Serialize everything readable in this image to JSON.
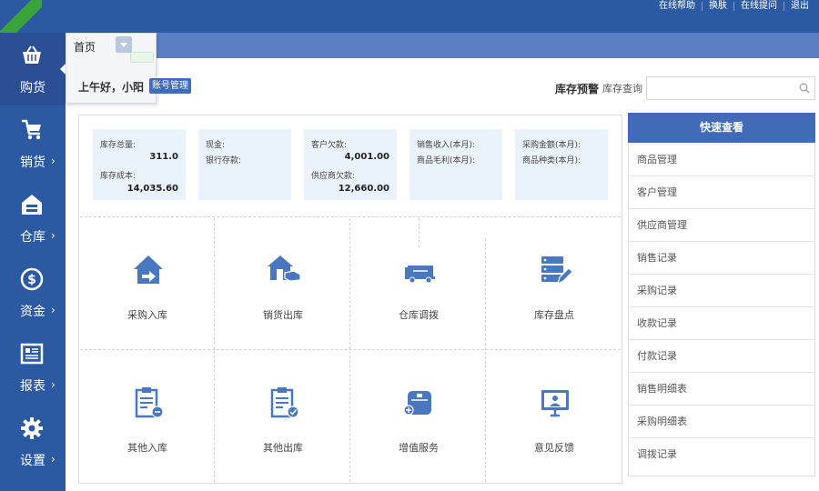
{
  "top_links": [
    "在线帮助",
    "换肤",
    "在线提问",
    "退出"
  ],
  "tab": {
    "home_label": "首页"
  },
  "sidebar": {
    "items": [
      {
        "label": "购货",
        "arrow": ""
      },
      {
        "label": "销货",
        "arrow": "›"
      },
      {
        "label": "仓库",
        "arrow": "›"
      },
      {
        "label": "资金",
        "arrow": "›"
      },
      {
        "label": "报表",
        "arrow": "›"
      },
      {
        "label": "设置",
        "arrow": "›"
      }
    ]
  },
  "greeting": {
    "text": "上午好，小阳",
    "account_btn": "账号管理"
  },
  "stock": {
    "warn_label": "库存预警",
    "query_label": "库存查询",
    "search_value": ""
  },
  "stats": [
    {
      "l1": "库存总量:",
      "v1": "311.0",
      "l2": "库存成本:",
      "v2": "14,035.60"
    },
    {
      "l1": "现金:",
      "v1": "",
      "l2": "银行存款:",
      "v2": ""
    },
    {
      "l1": "客户欠款:",
      "v1": "4,001.00",
      "l2": "供应商欠款:",
      "v2": "12,660.00"
    },
    {
      "l1": "销售收入(本月):",
      "v1": "",
      "l2": "商品毛利(本月):",
      "v2": ""
    },
    {
      "l1": "采购金额(本月):",
      "v1": "",
      "l2": "商品种类(本月):",
      "v2": ""
    }
  ],
  "tiles": [
    {
      "label": "采购入库",
      "icon": "house-arrow-icon"
    },
    {
      "label": "销货出库",
      "icon": "house-hand-icon"
    },
    {
      "label": "仓库调拨",
      "icon": "truck-icon"
    },
    {
      "label": "库存盘点",
      "icon": "server-edit-icon"
    },
    {
      "label": "其他入库",
      "icon": "clipboard-in-icon"
    },
    {
      "label": "其他出库",
      "icon": "clipboard-check-icon"
    },
    {
      "label": "增值服务",
      "icon": "service-box-icon"
    },
    {
      "label": "意见反馈",
      "icon": "monitor-user-icon"
    }
  ],
  "quick": {
    "title": "快速查看",
    "items": [
      "商品管理",
      "客户管理",
      "供应商管理",
      "销售记录",
      "采购记录",
      "收款记录",
      "付款记录",
      "销售明细表",
      "采购明细表",
      "调拨记录"
    ]
  },
  "colors": {
    "primary": "#2b5aa3",
    "accent": "#3f6bb8",
    "tile_icon": "#4a78c0",
    "stat_bg": "#eaf3fb"
  }
}
